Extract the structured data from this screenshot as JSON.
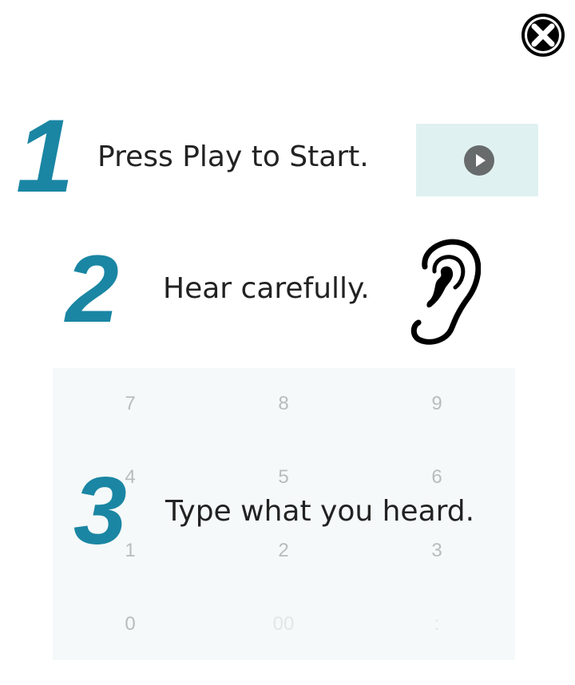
{
  "close": {
    "icon": "close-x-icon"
  },
  "steps": [
    {
      "number": "1",
      "text": "Press Play to Start."
    },
    {
      "number": "2",
      "text": "Hear carefully."
    },
    {
      "number": "3",
      "text": "Type what you heard."
    }
  ],
  "play_button": {
    "icon": "play-circle-icon",
    "panel_color": "#e0f1f1"
  },
  "ear": {
    "icon": "ear-icon"
  },
  "keypad": {
    "background": "#f5f9f9",
    "rows": [
      [
        "7",
        "8",
        "9"
      ],
      [
        "4",
        "5",
        "6"
      ],
      [
        "1",
        "2",
        "3"
      ],
      [
        "0",
        "00",
        ":"
      ]
    ]
  },
  "colors": {
    "accent": "#1a86a3",
    "text": "#222222",
    "key_text": "#b9bcbc"
  }
}
